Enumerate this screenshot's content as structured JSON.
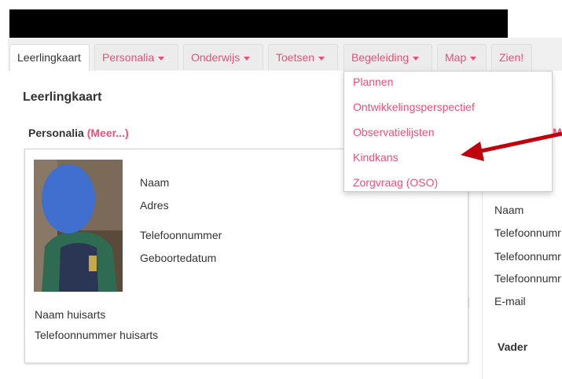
{
  "tabs": [
    {
      "label": "Leerlingkaart",
      "active": true,
      "dropdown": false
    },
    {
      "label": "Personalia",
      "active": false,
      "dropdown": true
    },
    {
      "label": "Onderwijs",
      "active": false,
      "dropdown": true
    },
    {
      "label": "Toetsen",
      "active": false,
      "dropdown": true
    },
    {
      "label": "Begeleiding",
      "active": false,
      "dropdown": true
    },
    {
      "label": "Map",
      "active": false,
      "dropdown": true
    },
    {
      "label": "Zien!",
      "active": false,
      "dropdown": false
    }
  ],
  "dropdown_menu": {
    "items": [
      {
        "label": "Plannen"
      },
      {
        "label": "Ontwikkelingsperspectief"
      },
      {
        "label": "Observatielijsten"
      },
      {
        "label": "Kindkans"
      },
      {
        "label": "Zorgvraag (OSO)"
      }
    ]
  },
  "main": {
    "title": "Leerlingkaart",
    "section_title": "Personalia",
    "section_more": "(Meer...)",
    "fields": [
      {
        "label": "Naam"
      },
      {
        "label": "Adres"
      },
      {
        "label": "Telefoonnummer"
      },
      {
        "label": "Geboortedatum"
      }
    ],
    "lower_fields": [
      {
        "label": "Naam huisarts"
      },
      {
        "label": "Telefoonnummer huisarts"
      }
    ]
  },
  "right_column": {
    "fields": [
      {
        "label": "Naam"
      },
      {
        "label": "Telefoonnumr"
      },
      {
        "label": "Telefoonnumr"
      },
      {
        "label": "Telefoonnumr"
      },
      {
        "label": "E-mail"
      }
    ],
    "subheading": "Vader",
    "pink_fragment": "M"
  },
  "colors": {
    "accent": "#e8507a",
    "arrow": "#c0000c",
    "avatar_overlay": "#3f6fcf"
  },
  "icons": {
    "tab_caret": "caret-down-icon",
    "arrow": "red-arrow-annotation"
  }
}
